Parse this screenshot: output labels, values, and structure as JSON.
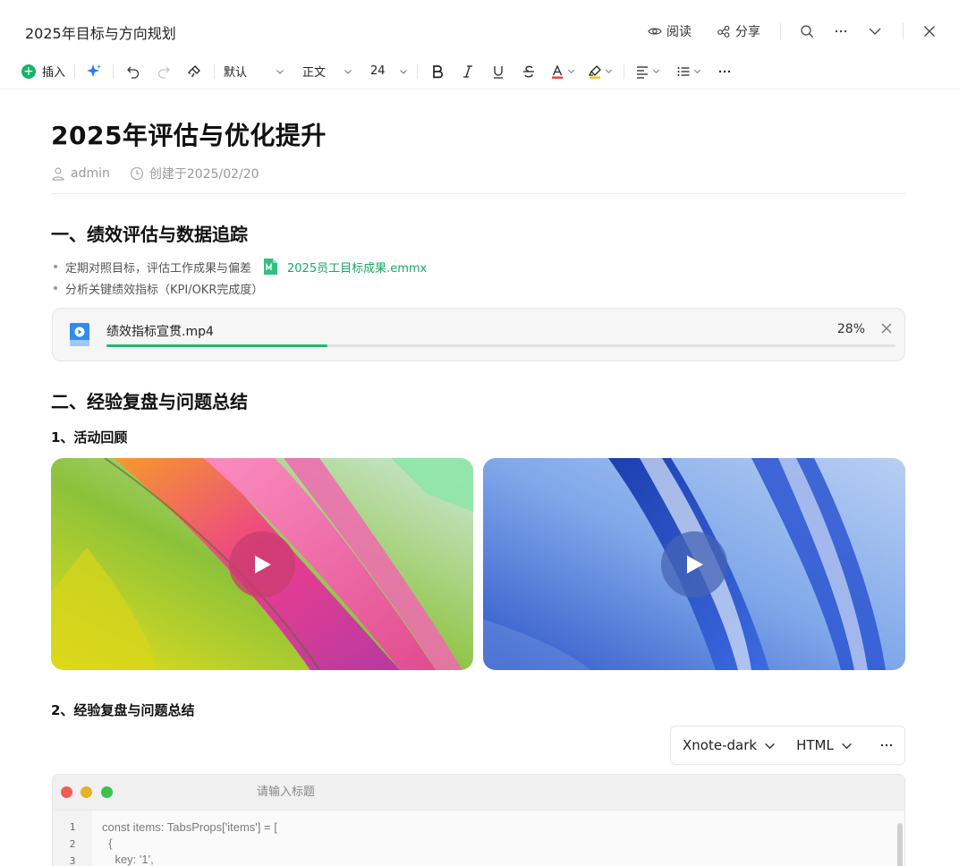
{
  "window": {
    "title": "2025年目标与方向规划",
    "read_label": "阅读",
    "share_label": "分享"
  },
  "toolbar": {
    "insert_label": "插入",
    "font_family": "默认",
    "paragraph_style": "正文",
    "font_size": "24"
  },
  "doc": {
    "title": "2025年评估与优化提升",
    "author": "admin",
    "created": "创建于2025/02/20"
  },
  "section1": {
    "heading": "一、绩效评估与数据追踪",
    "bullets": [
      "定期对照目标，评估工作成果与偏差",
      "分析关键绩效指标（KPI/OKR完成度）"
    ],
    "attachment_name": "2025员工目标成果.emmx"
  },
  "upload": {
    "file_name": "绩效指标宣贯.mp4",
    "progress_text": "28%",
    "progress": 0.28
  },
  "section2": {
    "heading": "二、经验复盘与问题总结",
    "sub1": "1、活动回顾",
    "sub2": "2、经验复盘与问题总结"
  },
  "code_block": {
    "theme": "Xnote-dark",
    "language": "HTML",
    "title_placeholder": "请输入标题",
    "lines": [
      "const items: TabsProps['items'] = [",
      "  {",
      "    key: '1',"
    ],
    "line_numbers": [
      "1",
      "2",
      "3"
    ]
  },
  "colors": {
    "accent_green": "#18b26b",
    "link_green": "#18a862",
    "progress_green": "#1fb874"
  }
}
